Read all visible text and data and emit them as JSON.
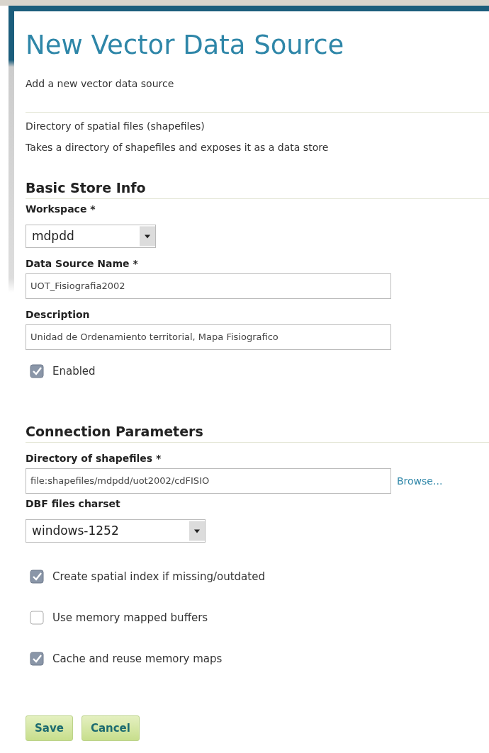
{
  "title": "New Vector Data Source",
  "subtitle": "Add a new vector data source",
  "store_type": {
    "name": "Directory of spatial files (shapefiles)",
    "description": "Takes a directory of shapefiles and exposes it as a data store"
  },
  "sections": [
    {
      "heading": "Basic Store Info",
      "fields": [
        {
          "kind": "select",
          "label": "Workspace *",
          "value": "mdpdd"
        },
        {
          "kind": "text",
          "label": "Data Source Name *",
          "value": "UOT_Fisiografia2002"
        },
        {
          "kind": "text",
          "label": "Description",
          "value": "Unidad de Ordenamiento territorial, Mapa Fisiografico"
        },
        {
          "kind": "checkbox",
          "label": "Enabled",
          "checked": true
        }
      ]
    },
    {
      "heading": "Connection Parameters",
      "fields": [
        {
          "kind": "path",
          "label": "Directory of shapefiles *",
          "value": "file:shapefiles/mdpdd/uot2002/cdFISIO",
          "link": "Browse..."
        },
        {
          "kind": "select",
          "label": "DBF files charset",
          "value": "windows-1252"
        },
        {
          "kind": "checkbox",
          "label": "Create spatial index if missing/outdated",
          "checked": true
        },
        {
          "kind": "checkbox",
          "label": "Use memory mapped buffers",
          "checked": false
        },
        {
          "kind": "checkbox",
          "label": "Cache and reuse memory maps",
          "checked": true
        }
      ]
    }
  ],
  "buttons": [
    "Save",
    "Cancel"
  ]
}
